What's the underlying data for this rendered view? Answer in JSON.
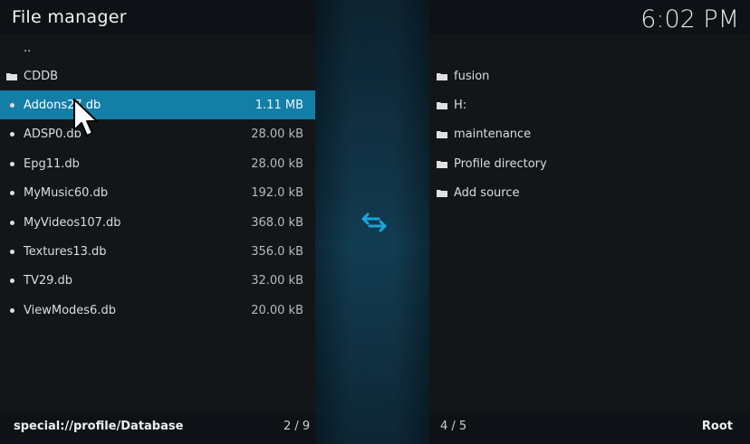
{
  "header": {
    "title": "File manager",
    "clock": "6:02 PM"
  },
  "left_list": {
    "items": [
      {
        "label": "..",
        "size": "",
        "kind": "parent"
      },
      {
        "label": "CDDB",
        "size": "",
        "kind": "folder"
      },
      {
        "label": "Addons27.db",
        "size": "1.11 MB",
        "kind": "file",
        "selected": true
      },
      {
        "label": "ADSP0.db",
        "size": "28.00 kB",
        "kind": "file"
      },
      {
        "label": "Epg11.db",
        "size": "28.00 kB",
        "kind": "file"
      },
      {
        "label": "MyMusic60.db",
        "size": "192.0 kB",
        "kind": "file"
      },
      {
        "label": "MyVideos107.db",
        "size": "368.0 kB",
        "kind": "file"
      },
      {
        "label": "Textures13.db",
        "size": "356.0 kB",
        "kind": "file"
      },
      {
        "label": "TV29.db",
        "size": "32.00 kB",
        "kind": "file"
      },
      {
        "label": "ViewModes6.db",
        "size": "20.00 kB",
        "kind": "file"
      }
    ],
    "footer_path": "special://profile/Database",
    "footer_count": "2 / 9"
  },
  "right_list": {
    "items": [
      {
        "label": "fusion",
        "kind": "folder"
      },
      {
        "label": "H:",
        "kind": "folder"
      },
      {
        "label": "maintenance",
        "kind": "folder"
      },
      {
        "label": "Profile directory",
        "kind": "folder"
      },
      {
        "label": "Add source",
        "kind": "folder"
      }
    ],
    "footer_count": "4 / 5",
    "footer_path": "Root"
  },
  "icons": {
    "swap": "swap-arrows-icon",
    "folder": "folder-icon",
    "file": "file-dot-icon",
    "cursor": "mouse-cursor-icon"
  },
  "colors": {
    "selection": "#137ea6",
    "accent": "#1aa7d8"
  }
}
